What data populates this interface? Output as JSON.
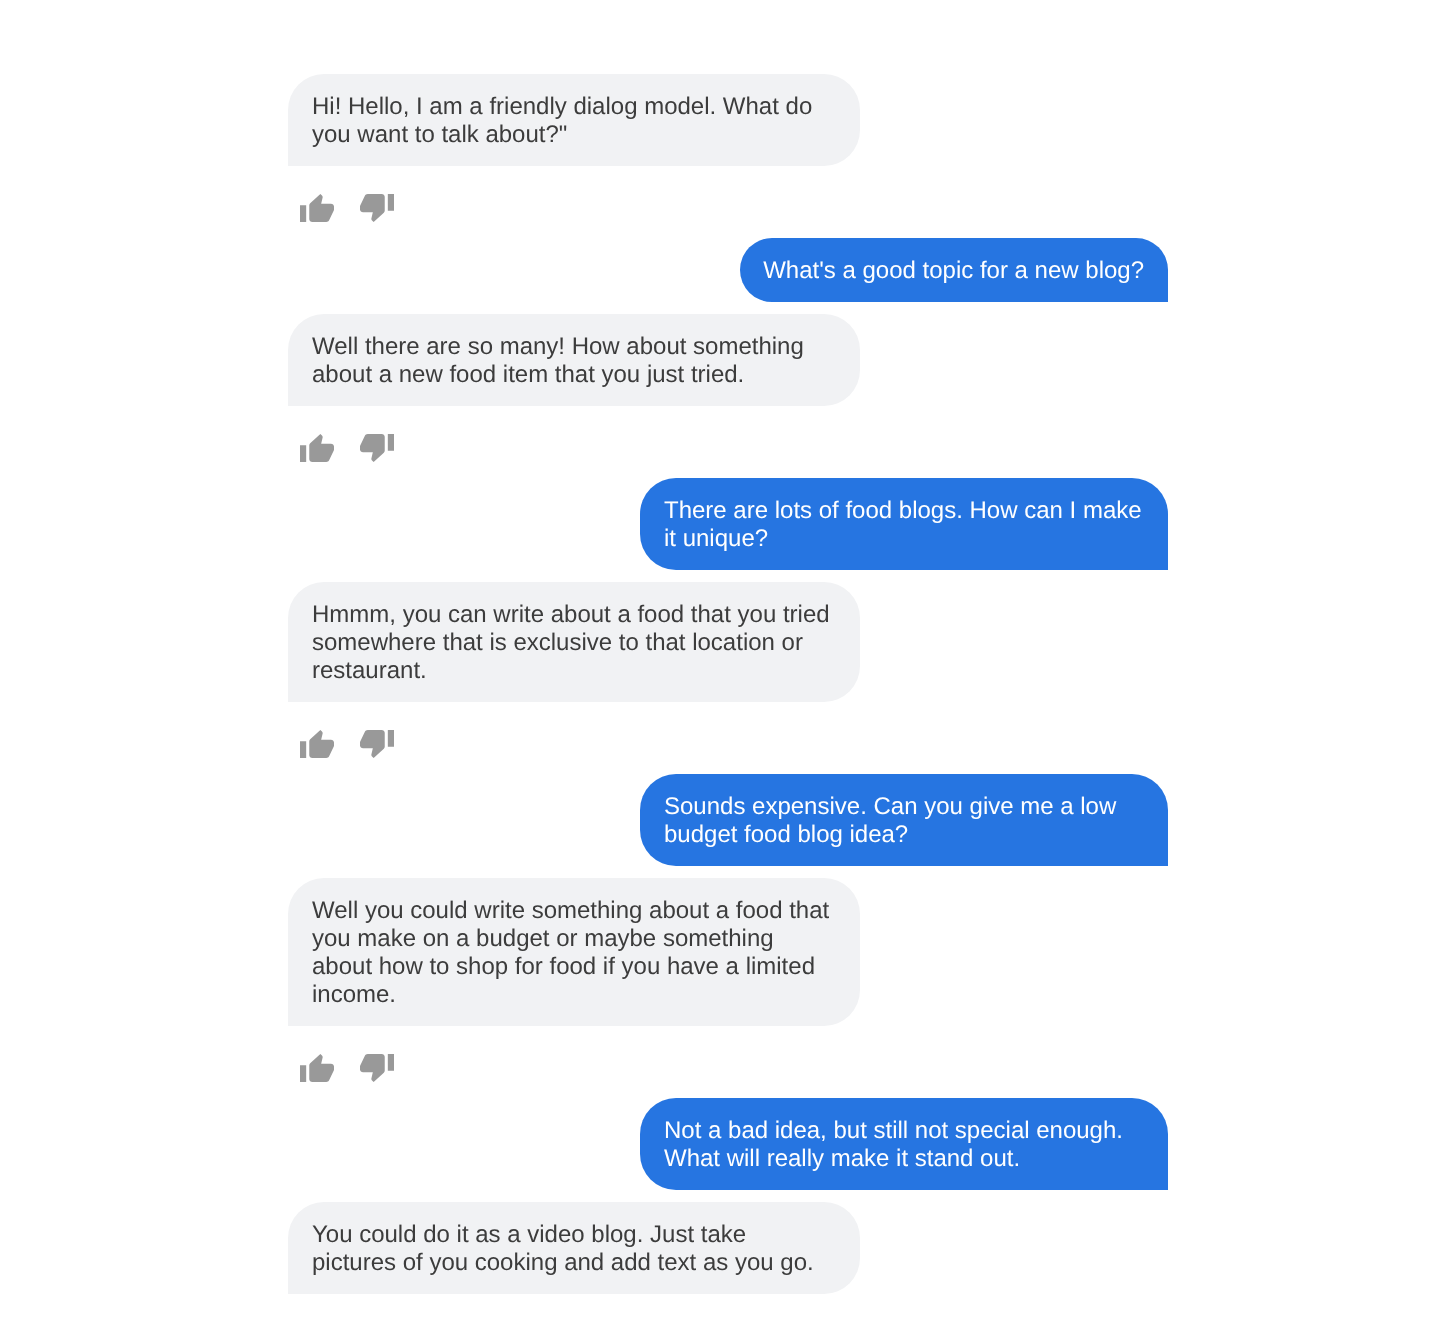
{
  "messages": [
    {
      "kind": "bot",
      "text": "Hi! Hello, I am a friendly dialog model. What do you want to talk about?\"",
      "feedback": true
    },
    {
      "kind": "user",
      "text": "What's a good topic for a new blog?"
    },
    {
      "kind": "bot",
      "text": "Well there are so many! How about something about a new food item that you just tried.",
      "feedback": true
    },
    {
      "kind": "user",
      "text": "There are lots of food blogs. How can I make it unique?"
    },
    {
      "kind": "bot",
      "text": "Hmmm, you can write about a food that you tried somewhere that is exclusive to that location or restaurant.",
      "feedback": true
    },
    {
      "kind": "user",
      "text": "Sounds expensive. Can you give me a low budget food blog idea?"
    },
    {
      "kind": "bot",
      "text": "Well you could write something about a food that you make on a budget or maybe something about how to shop for food if you have a limited income.",
      "feedback": true
    },
    {
      "kind": "user",
      "text": "Not a bad idea, but still not special enough. What will really make it stand out."
    },
    {
      "kind": "bot",
      "text": "You could do it as a video blog. Just take pictures of you cooking and add text as you go.",
      "feedback": false
    }
  ]
}
